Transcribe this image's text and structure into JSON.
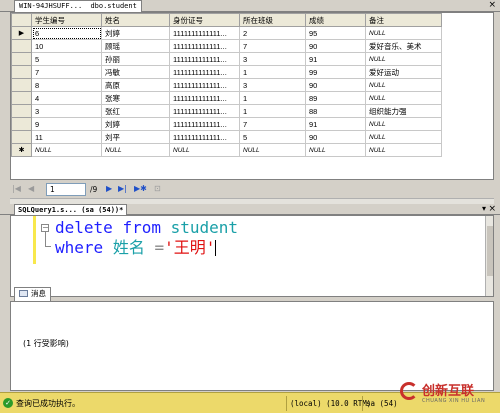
{
  "doc_tab": {
    "server": "WIN-94JHSUFF...",
    "object": "dbo.student"
  },
  "grid": {
    "columns": [
      "学生编号",
      "姓名",
      "身份证号",
      "所在班级",
      "成绩",
      "备注"
    ],
    "rows": [
      [
        "6",
        "刘婷",
        "1111111111111...",
        "2",
        "95",
        "NULL"
      ],
      [
        "10",
        "顾瑶",
        "1111111111111...",
        "7",
        "90",
        "爱好音乐、美术"
      ],
      [
        "5",
        "孙丽",
        "1111111111111...",
        "3",
        "91",
        "NULL"
      ],
      [
        "7",
        "冯敏",
        "1111111111111...",
        "1",
        "99",
        "爱好运动"
      ],
      [
        "8",
        "高原",
        "1111111111111...",
        "3",
        "90",
        "NULL"
      ],
      [
        "4",
        "张寒",
        "1111111111111...",
        "1",
        "89",
        "NULL"
      ],
      [
        "3",
        "张红",
        "1111111111111...",
        "1",
        "88",
        "组织能力强"
      ],
      [
        "9",
        "刘婷",
        "1111111111111...",
        "7",
        "91",
        "NULL"
      ],
      [
        "11",
        "刘平",
        "1111111111111...",
        "5",
        "90",
        "NULL"
      ],
      [
        "NULL",
        "NULL",
        "NULL",
        "NULL",
        "NULL",
        "NULL"
      ]
    ],
    "row_markers": [
      "▶",
      "",
      "",
      "",
      "",
      "",
      "",
      "",
      "",
      "✱"
    ]
  },
  "nav": {
    "current": "1",
    "total": "/9"
  },
  "editor_tab": {
    "title": "SQLQuery1.s... (sa (54))*"
  },
  "editor": {
    "line1": {
      "kw1": "delete",
      "kw2": "from",
      "table": "student"
    },
    "line2": {
      "kw": "where",
      "field": "姓名",
      "op": "=",
      "value": "'王明'"
    }
  },
  "messages": {
    "tab_label": "消息",
    "text": "(1 行受影响)"
  },
  "status": {
    "message": "查询已成功执行。",
    "server": "(local) (10.0 RTM)",
    "user": "sa (54)"
  },
  "watermark": {
    "brand": "创新互联",
    "sub": "CHUANG XIN HU LIAN"
  }
}
